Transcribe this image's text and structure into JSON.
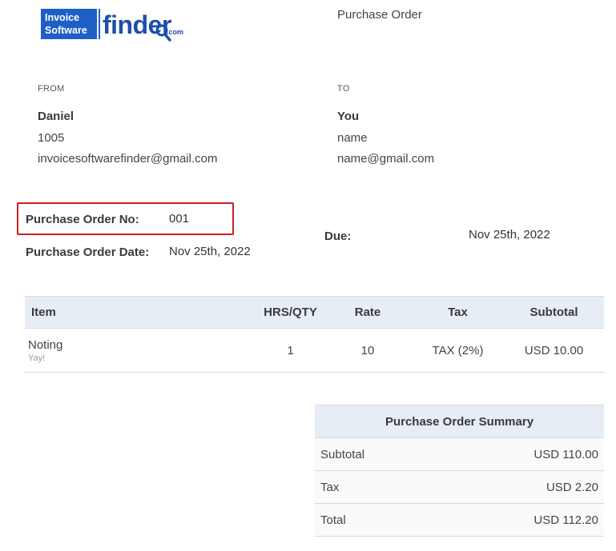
{
  "logo": {
    "line1": "Invoice",
    "line2": "Software",
    "word": "finder",
    "tld": ".com"
  },
  "title": "Purchase Order",
  "from": {
    "label": "FROM",
    "name": "Daniel",
    "line1": "1005",
    "email": "invoicesoftwarefinder@gmail.com"
  },
  "to": {
    "label": "TO",
    "name": "You",
    "line1": "name",
    "email": "name@gmail.com"
  },
  "order": {
    "number_label": "Purchase Order No:",
    "number": "001",
    "date_label": "Purchase Order Date:",
    "date": "Nov 25th, 2022",
    "due_label": "Due:",
    "due": "Nov 25th, 2022"
  },
  "colors": {
    "brand": "#1d5fc4",
    "highlight": "#cc1f1f",
    "header_bg": "#e6edf5"
  },
  "items_table": {
    "headers": [
      "Item",
      "HRS/QTY",
      "Rate",
      "Tax",
      "Subtotal"
    ],
    "rows": [
      {
        "item": "Noting",
        "desc": "Yay!",
        "qty": "1",
        "rate": "10",
        "tax": "TAX (2%)",
        "subtotal": "USD 10.00"
      }
    ]
  },
  "summary": {
    "title": "Purchase Order Summary",
    "rows": [
      {
        "label": "Subtotal",
        "value": "USD 110.00"
      },
      {
        "label": "Tax",
        "value": "USD 2.20"
      },
      {
        "label": "Total",
        "value": "USD 112.20"
      }
    ]
  }
}
